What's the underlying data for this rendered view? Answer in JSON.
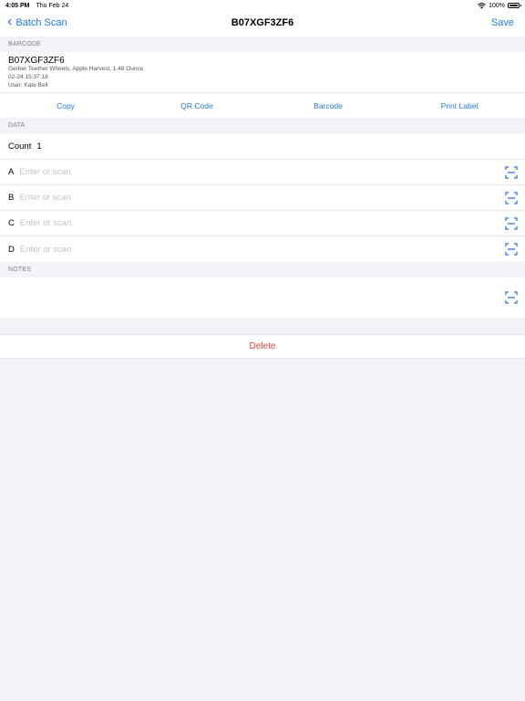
{
  "status_bar": {
    "time": "4:05 PM",
    "date": "Thu Feb 24",
    "battery": "100%",
    "battery_level": 1.0
  },
  "nav": {
    "back_label": "Batch Scan",
    "title": "B07XGF3ZF6",
    "save_label": "Save"
  },
  "barcode_section": {
    "header": "BARCODE",
    "code": "B07XGF3ZF6",
    "description": "Gerber Teether Wheels, Apple Harvest, 1.48 Ounce",
    "timestamp": "02-24 15:37:18",
    "user": "User: Kate Bell",
    "actions": [
      "Copy",
      "QR Code",
      "Barcode",
      "Print Label"
    ]
  },
  "data_section": {
    "header": "DATA",
    "count_label": "Count",
    "count_value": "1",
    "fields": [
      {
        "label": "A",
        "placeholder": "Enter or scan"
      },
      {
        "label": "B",
        "placeholder": "Enter or scan"
      },
      {
        "label": "C",
        "placeholder": "Enter or scan"
      },
      {
        "label": "D",
        "placeholder": "Enter or scan"
      }
    ]
  },
  "notes_section": {
    "header": "NOTES"
  },
  "delete_label": "Delete",
  "colors": {
    "accent": "#1e7bf3",
    "destructive": "#ff3b30",
    "background": "#f2f2f7"
  },
  "icons": {
    "scan": "scan-frame-icon",
    "back": "chevron-left-icon",
    "wifi": "wifi-icon",
    "battery": "battery-icon"
  }
}
